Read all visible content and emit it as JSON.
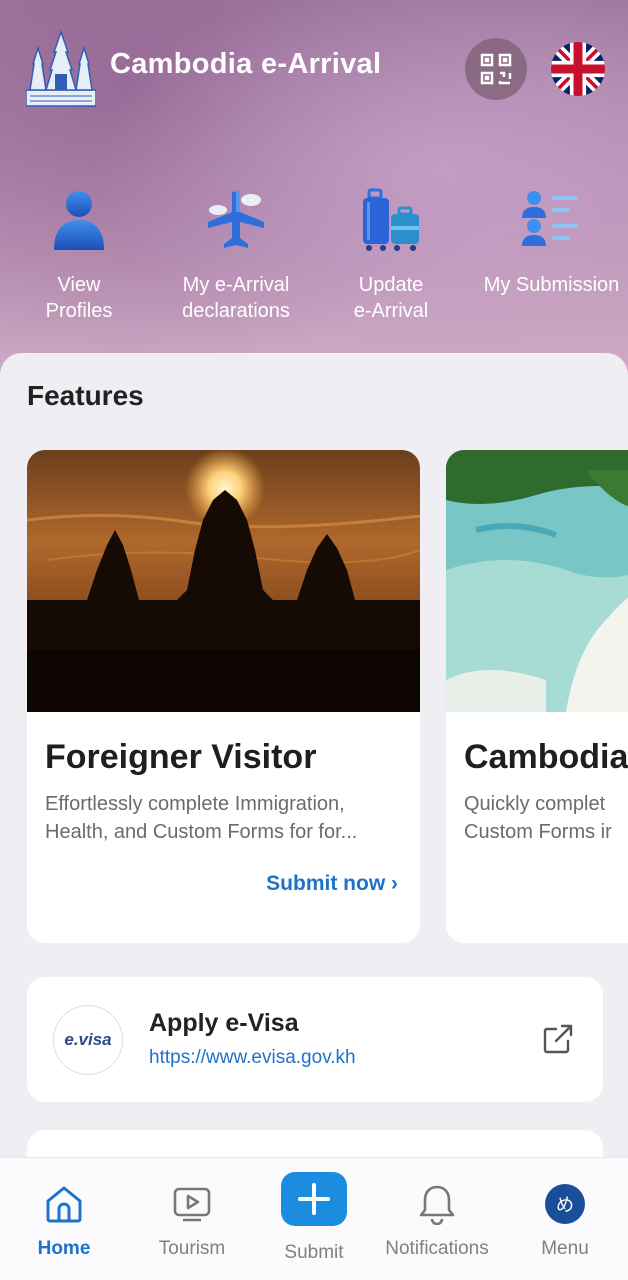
{
  "header": {
    "title": "Cambodia e-Arrival"
  },
  "quick_actions": [
    {
      "line1": "View",
      "line2": "Profiles"
    },
    {
      "line1": "My e-Arrival",
      "line2": "declarations"
    },
    {
      "line1": "Update",
      "line2": "e-Arrival"
    },
    {
      "line1": "My Submission",
      "line2": ""
    }
  ],
  "features": {
    "title": "Features",
    "cards": [
      {
        "title": "Foreigner Visitor",
        "desc_line1": "Effortlessly complete Immigration,",
        "desc_line2": "Health, and Custom Forms for for...",
        "link": "Submit now ›"
      },
      {
        "title": "Cambodia",
        "desc_line1": "Quickly complet",
        "desc_line2": "Custom Forms ir",
        "link": ""
      }
    ]
  },
  "evisa": {
    "logo_text": "e.visa",
    "title": "Apply e-Visa",
    "url": "https://www.evisa.gov.kh"
  },
  "nav": [
    {
      "label": "Home",
      "icon": "home-icon",
      "active": true
    },
    {
      "label": "Tourism",
      "icon": "play-icon",
      "active": false
    },
    {
      "label": "Submit",
      "icon": "plus-icon",
      "active": false
    },
    {
      "label": "Notifications",
      "icon": "bell-icon",
      "active": false
    },
    {
      "label": "Menu",
      "icon": "avatar",
      "active": false,
      "avatar_text": "め"
    }
  ],
  "colors": {
    "accent": "#1c73c9",
    "submit_button": "#1a8de0"
  }
}
